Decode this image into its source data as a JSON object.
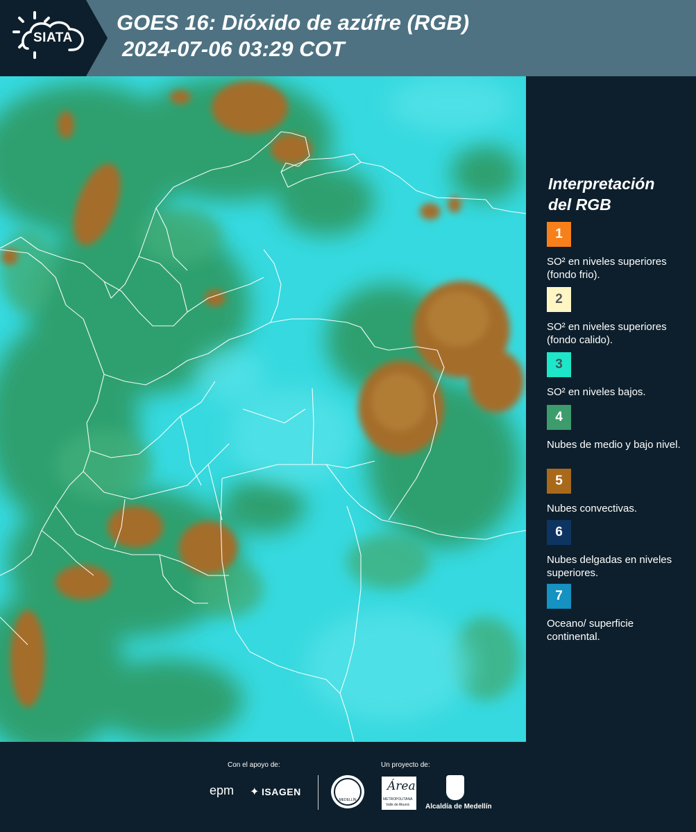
{
  "header": {
    "logo_text": "SIATA",
    "title_line1": "GOES 16: Dióxido de azúfre (RGB)",
    "title_line2": "2024-07-06 03:29 COT"
  },
  "legend": {
    "title_line1": "Interpretación",
    "title_line2": "del RGB",
    "items": [
      {
        "number": "1",
        "color": "#f7801a",
        "numcolor": "#ffffff",
        "label": "SO² en niveles superiores (fondo frio)."
      },
      {
        "number": "2",
        "color": "#fff6c4",
        "numcolor": "#5a5a5a",
        "label": "SO² en niveles superiores (fondo calido)."
      },
      {
        "number": "3",
        "color": "#1ee6c9",
        "numcolor": "#3a5a5a",
        "label": "SO² en niveles bajos."
      },
      {
        "number": "4",
        "color": "#3c9c6c",
        "numcolor": "#ffffff",
        "label": "Nubes de medio y bajo nivel."
      },
      {
        "number": "5",
        "color": "#a9691a",
        "numcolor": "#ffffff",
        "label": "Nubes convectivas."
      },
      {
        "number": "6",
        "color": "#0e3462",
        "numcolor": "#ffffff",
        "label": "Nubes delgadas en niveles superiores."
      },
      {
        "number": "7",
        "color": "#1591c2",
        "numcolor": "#ffffff",
        "label": "Oceano/ superficie continental."
      }
    ]
  },
  "footer": {
    "support_label": "Con el apoyo de:",
    "project_label": "Un proyecto de:",
    "sponsor_epm": "epm",
    "sponsor_isagen": "ISAGEN",
    "area_name": "Área",
    "area_sub1": "METROPOLITANA",
    "area_sub2": "Valle de Aburrá",
    "alcaldia": "Alcaldía de Medellín",
    "medellin_seal": "MEDELLÍN"
  }
}
